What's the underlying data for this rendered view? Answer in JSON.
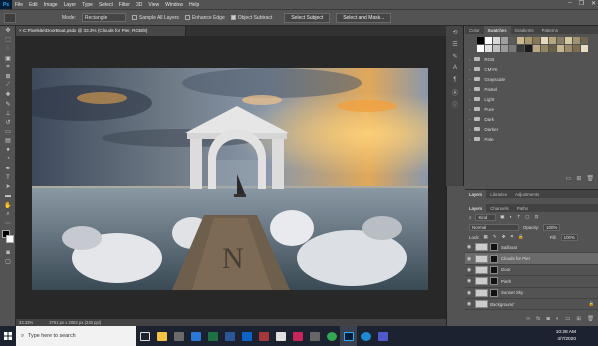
{
  "menubar": {
    "logo": "Ps",
    "items": [
      "File",
      "Edit",
      "Image",
      "Layer",
      "Type",
      "Select",
      "Filter",
      "3D",
      "View",
      "Window",
      "Help"
    ],
    "window_controls": [
      "–",
      "❐",
      "✕"
    ]
  },
  "options": {
    "mode_label": "Mode:",
    "mode_value": "Rectangle",
    "sample_all": "Sample All Layers",
    "enhance_edge": "Enhance Edge",
    "object_subtract": "Object Subtract",
    "select_subject": "Select Subject",
    "select_mask": "Select and Mask..."
  },
  "document": {
    "tab_title": "C:Pixelsite\\DoorBoat.psdx @ 33.3% (Clouds for Pier, RGB/8)",
    "zoom": "33.33%",
    "doc_info": "3751 px x 2082 px (240 ppi)"
  },
  "swatches": {
    "tabs": [
      "Color",
      "Swatches",
      "Gradients",
      "Patterns"
    ],
    "active": "Swatches",
    "colors": [
      "#000000",
      "#ffffff",
      "#d8d8d8",
      "#a0a0a0",
      "#5a5a5a",
      "#c9b98e",
      "#a8976d",
      "#8a7654",
      "#e3d9bd",
      "#b7a57c",
      "#877c66",
      "#d7c8a0",
      "#a09472",
      "#6f6650",
      "#ffffff",
      "#e0e0e0",
      "#c0c0c0",
      "#9a9a9a",
      "#7a7a7a",
      "#3a3a3a",
      "#1a1a1a",
      "#bba882",
      "#928463",
      "#6a5f48",
      "#c6b48b",
      "#9d8a6a",
      "#7e6d50",
      "#e6dcc2"
    ],
    "folders": [
      "RGB",
      "CMYK",
      "Grayscale",
      "Pastel",
      "Light",
      "Pure",
      "Dark",
      "Darker",
      "Pale"
    ]
  },
  "layers_panel": {
    "top_tabs": [
      "Layers",
      "Libraries",
      "Adjustments"
    ],
    "tabs": [
      "Layers",
      "Channels",
      "Paths"
    ],
    "active_tab": "Layers",
    "kind": "Kind",
    "blend_mode": "Normal",
    "opacity_label": "Opacity:",
    "opacity": "100%",
    "lock_label": "Lock:",
    "fill_label": "Fill:",
    "fill": "100%",
    "layers": [
      {
        "name": "Sailboat",
        "selected": false,
        "italic": false
      },
      {
        "name": "Clouds for Pier",
        "selected": true,
        "italic": false
      },
      {
        "name": "Door",
        "selected": false,
        "italic": false
      },
      {
        "name": "Pieth",
        "selected": false,
        "italic": false
      },
      {
        "name": "Sunset Sky",
        "selected": false,
        "italic": false
      },
      {
        "name": "Background",
        "selected": false,
        "italic": true
      }
    ]
  },
  "taskbar": {
    "search_placeholder": "Type here to search",
    "time": "10:28 AM",
    "date": "4/7/2020"
  }
}
